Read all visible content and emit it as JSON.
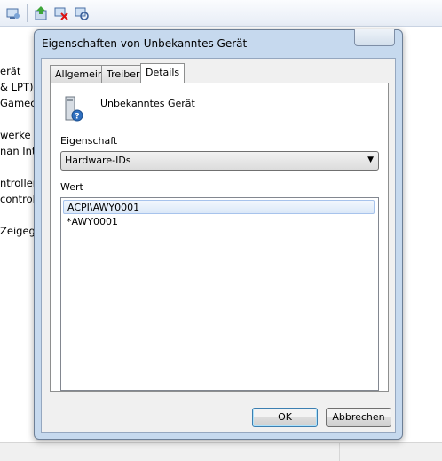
{
  "toolbar": {
    "icons": [
      "device-settings-icon",
      "update-driver-icon",
      "uninstall-device-icon",
      "scan-hardware-icon"
    ]
  },
  "background_tree": {
    "items": [
      "erät",
      "& LPT)",
      "Gamec",
      "werke",
      "nan Inte",
      "ntroller",
      "controll",
      "Zeigege"
    ]
  },
  "dialog": {
    "title": "Eigenschaften von Unbekanntes Gerät",
    "tabs": [
      "Allgemein",
      "Treiber",
      "Details"
    ],
    "active_tab": "Details",
    "device_name": "Unbekanntes Gerät",
    "property_label": "Eigenschaft",
    "property_selected": "Hardware-IDs",
    "value_label": "Wert",
    "values": [
      "ACPI\\AWY0001",
      "*AWY0001"
    ],
    "selected_value_index": 0,
    "ok_label": "OK",
    "cancel_label": "Abbrechen"
  }
}
